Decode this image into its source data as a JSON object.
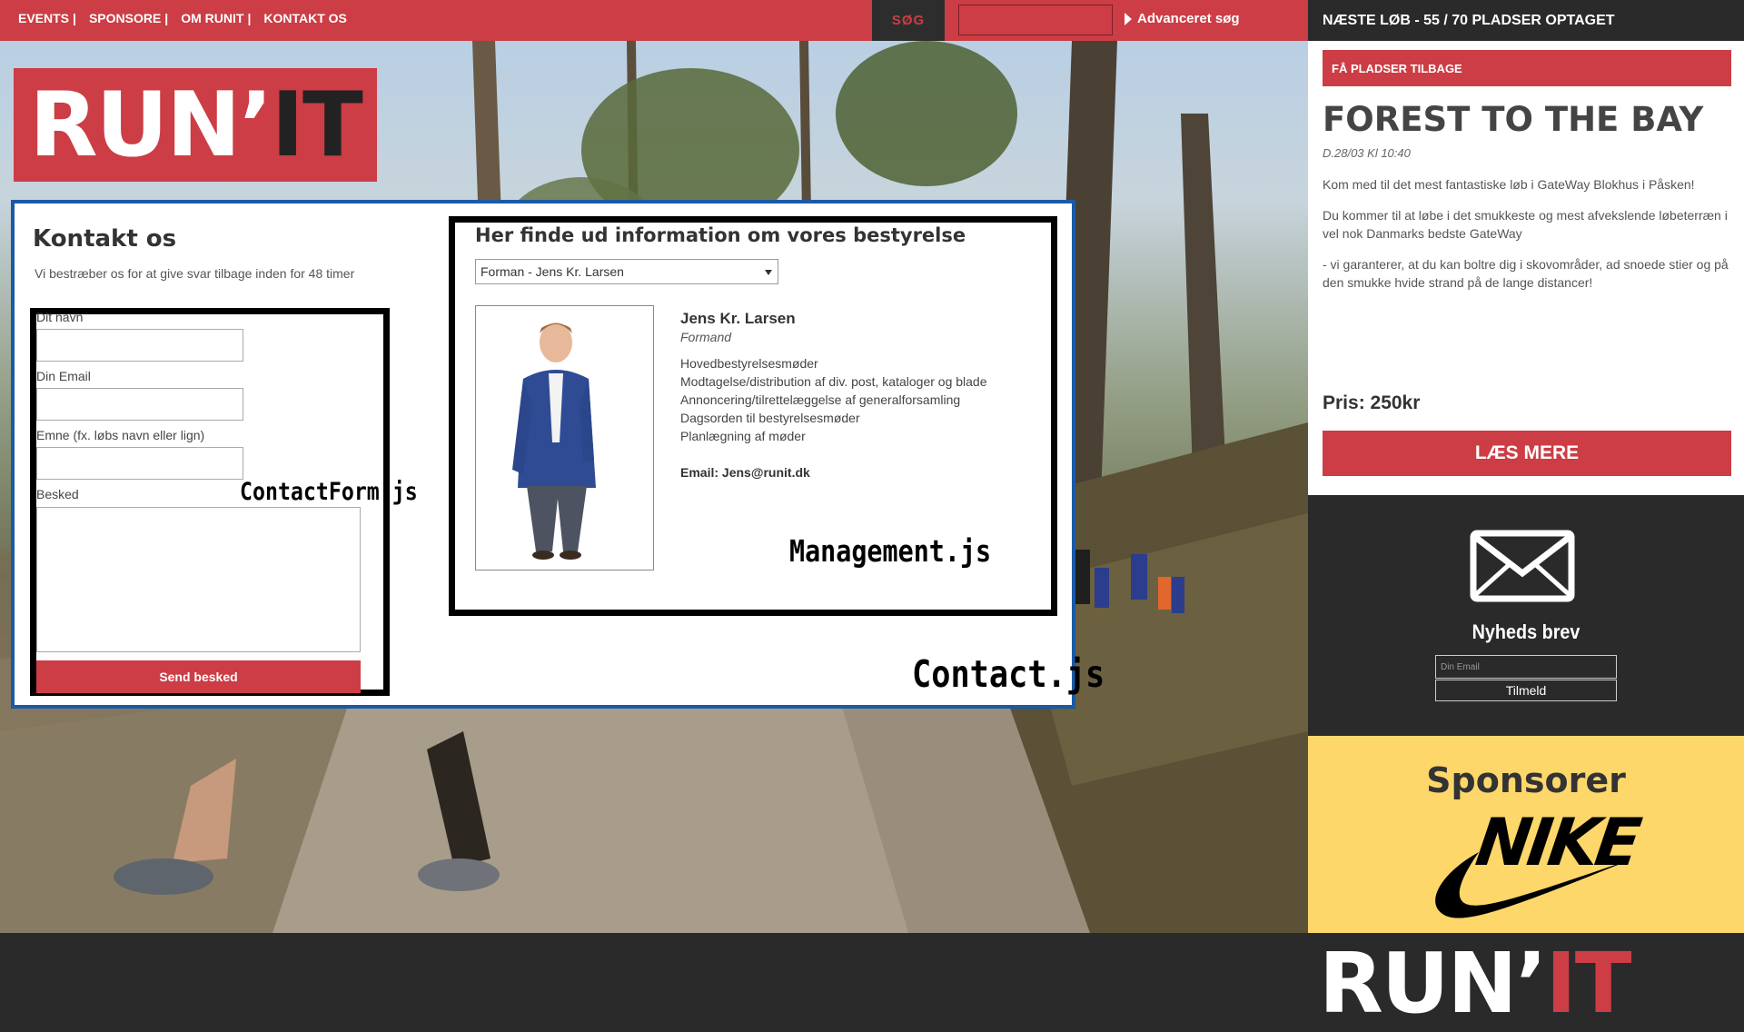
{
  "nav": {
    "items": [
      "EVENTS",
      "SPONSORE",
      "OM RUNIT",
      "KONTAKT OS"
    ],
    "separator": "|"
  },
  "search": {
    "label": "SØG",
    "advanced_label": "Advanceret søg"
  },
  "logo": {
    "part1": "RUN’",
    "part2": "IT"
  },
  "contact": {
    "title": "Kontakt os",
    "subtitle": "Vi bestræber os for at give svar tilbage inden for 48 timer",
    "form": {
      "name_label": "Dit navn",
      "email_label": "Din Email",
      "subject_label": "Emne (fx. løbs navn eller lign)",
      "message_label": "Besked",
      "send_label": "Send besked"
    },
    "component_tags": {
      "contact_form": "ContactForm.js",
      "management": "Management.js",
      "contact": "Contact.js"
    },
    "management": {
      "title": "Her finde ud information om vores bestyrelse",
      "selected_option": "Forman - Jens Kr. Larsen",
      "person_name": "Jens Kr. Larsen",
      "person_role": "Formand",
      "duties": [
        "Hovedbestyrelsesmøder",
        "Modtagelse/distribution af div. post, kataloger og blade",
        "Annoncering/tilrettelæggelse af generalforsamling",
        "Dagsorden til bestyrelsesmøder",
        "Planlægning af møder"
      ],
      "email": "Email: Jens@runit.dk"
    }
  },
  "sidebar": {
    "next_race": "NÆSTE LØB - 55 / 70 PLADSER OPTAGET",
    "refund_label": "FÅ PLADSER TILBAGE",
    "event_title": "FOREST TO THE BAY",
    "event_date": "D.28/03 Kl 10:40",
    "event_paragraphs": [
      "Kom med til det mest fantastiske løb i GateWay Blokhus i Påsken!",
      "Du kommer til at løbe i det smukkeste og mest afvekslende løbeterræn i vel nok Danmarks bedste GateWay",
      "- vi garanterer, at du kan boltre dig i skovområder, ad snoede stier og på den smukke hvide strand på de lange distancer!"
    ],
    "price": "Pris: 250kr",
    "read_more": "LÆS MERE",
    "newsletter": {
      "title": "Nyheds brev",
      "placeholder": "Din Email",
      "button": "Tilmeld"
    },
    "sponsors": {
      "title": "Sponsorer",
      "brand": "NIKE"
    }
  },
  "footer": {
    "logo_part1": "RUN’",
    "logo_part2": "IT"
  },
  "colors": {
    "brand_red": "#cc3d45",
    "dark": "#2a2a2a",
    "sponsor_yellow": "#fdd76a",
    "panel_border": "#1a5aa6"
  }
}
